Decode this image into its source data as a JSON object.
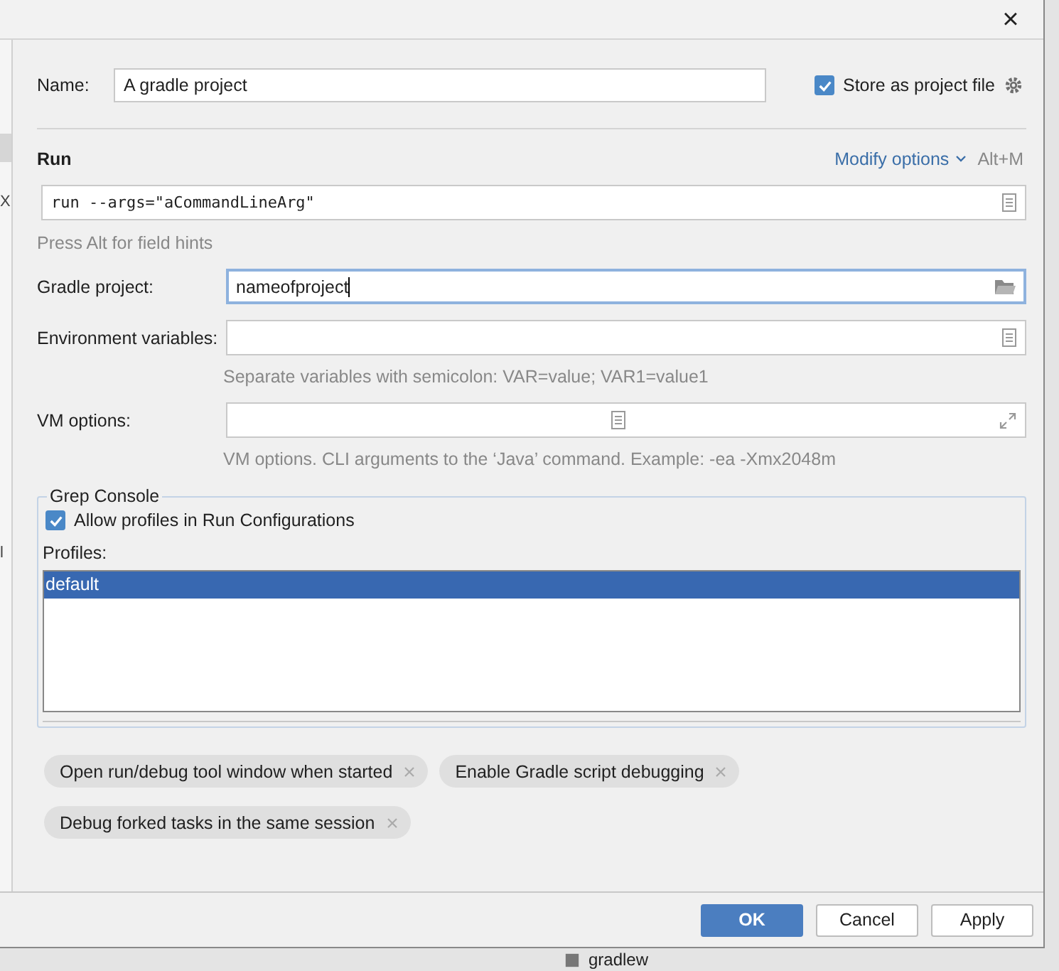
{
  "window": {
    "close": "×"
  },
  "sidebar_fragments": [
    "X",
    "l"
  ],
  "name_field": {
    "label": "Name:",
    "value": "A gradle project"
  },
  "store_as_project_file": {
    "label": "Store as project file",
    "checked": true
  },
  "run_section": {
    "title": "Run",
    "modify_options": "Modify options",
    "shortcut": "Alt+M",
    "command": "run --args=\"aCommandLineArg\"",
    "hint": "Press Alt for field hints"
  },
  "fields": [
    {
      "label": "Gradle project:",
      "value": "nameofproject",
      "focused": true,
      "kind": "folder"
    },
    {
      "label": "Environment variables:",
      "focused": false,
      "kind": "list",
      "hint": "Separate variables with semicolon: VAR=value; VAR1=value1"
    },
    {
      "label": "VM options:",
      "focused": false,
      "kind": "expand",
      "hint": "VM options. CLI arguments to the ‘Java’ command. Example: -ea -Xmx2048m"
    }
  ],
  "grep_console": {
    "title": "Grep Console",
    "allow_label": "Allow profiles in Run Configurations",
    "allow_checked": true,
    "profiles_label": "Profiles:",
    "profiles": [
      {
        "label": "default",
        "selected": true
      }
    ]
  },
  "option_tags": [
    [
      "Open run/debug tool window when started",
      "Enable Gradle script debugging"
    ],
    [
      "Debug forked tasks in the same session"
    ]
  ],
  "buttons": [
    {
      "label": "OK",
      "default": true
    },
    {
      "label": "Cancel",
      "default": false
    },
    {
      "label": "Apply",
      "default": false
    }
  ],
  "background": {
    "file": "gradlew"
  }
}
